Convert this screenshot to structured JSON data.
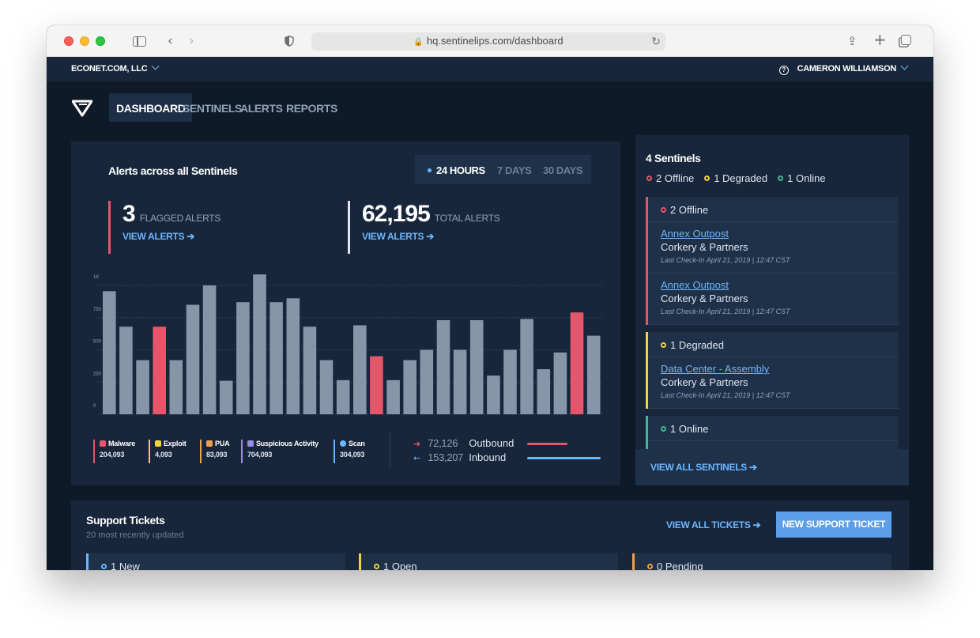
{
  "browser": {
    "url": "hq.sentinelips.com/dashboard"
  },
  "topbar": {
    "org": "ECONET.COM, LLC",
    "user": "CAMERON WILLIAMSON"
  },
  "nav": [
    "DASHBOARD",
    "SENTINELS",
    "ALERTS",
    "REPORTS"
  ],
  "alerts": {
    "title": "Alerts across all Sentinels",
    "ranges": [
      "24 HOURS",
      "7 DAYS",
      "30 DAYS"
    ],
    "flagged": {
      "value": "3",
      "label": "FLAGGED ALERTS",
      "link": "VIEW ALERTS ➔"
    },
    "total": {
      "value": "62,195",
      "label": "TOTAL ALERTS",
      "link": "VIEW ALERTS ➔"
    },
    "legend": [
      {
        "name": "Malware",
        "value": "204,093",
        "color": "#e5566a",
        "icon": "malware-icon"
      },
      {
        "name": "Exploit",
        "value": "4,093",
        "color": "#f4d03f",
        "icon": "hammer-icon"
      },
      {
        "name": "PUA",
        "value": "83,093",
        "color": "#f0a04b",
        "icon": "briefcase-icon"
      },
      {
        "name": "Suspicious Activity",
        "value": "704,093",
        "color": "#9b8be6",
        "icon": "spy-icon"
      },
      {
        "name": "Scan",
        "value": "304,093",
        "color": "#6bb6ff",
        "icon": "fingerprint-icon"
      }
    ],
    "traffic": [
      {
        "direction": "Outbound",
        "value": "72,126",
        "color": "#e5566a"
      },
      {
        "direction": "Inbound",
        "value": "153,207",
        "color": "#6bb6ff"
      }
    ]
  },
  "chart_data": {
    "type": "bar",
    "y_ticks": [
      "1K",
      "750",
      "500",
      "250",
      "0"
    ],
    "ylim": [
      0,
      1000
    ],
    "values": [
      955,
      680,
      420,
      680,
      420,
      850,
      1000,
      260,
      870,
      1085,
      870,
      900,
      680,
      420,
      265,
      690,
      450,
      265,
      420,
      500,
      730,
      500,
      730,
      300,
      500,
      740,
      350,
      480,
      790,
      610
    ],
    "flagged_indices": [
      3,
      16,
      28
    ],
    "colors": {
      "normal": "#8795a8",
      "flagged": "#e5566a"
    },
    "grid": true
  },
  "sentinels": {
    "title": "4 Sentinels",
    "summary": [
      {
        "label": "2 Offline",
        "color": "#e5566a"
      },
      {
        "label": "1 Degraded",
        "color": "#f4d03f"
      },
      {
        "label": "1 Online",
        "color": "#3fb98f"
      }
    ],
    "groups": [
      {
        "label": "2 Offline",
        "color": "#e5566a",
        "entries": [
          {
            "name": "Annex Outpost",
            "org": "Corkery & Partners",
            "checkin": "Last Check-In April 21, 2019 | 12:47 CST"
          },
          {
            "name": "Annex Outpost",
            "org": "Corkery & Partners",
            "checkin": "Last Check-In April 21, 2019 | 12:47 CST"
          }
        ]
      },
      {
        "label": "1 Degraded",
        "color": "#f4d03f",
        "entries": [
          {
            "name": "Data Center - Assembly",
            "org": "Corkery & Partners",
            "checkin": "Last Check-In April 21, 2019 | 12:47 CST"
          }
        ]
      },
      {
        "label": "1 Online",
        "color": "#3fb98f",
        "entries": []
      }
    ],
    "footer_link": "VIEW ALL SENTINELS ➔"
  },
  "tickets": {
    "title": "Support Tickets",
    "subtitle": "20 most recently updated",
    "view_all": "VIEW ALL TICKETS ➔",
    "new_button": "NEW SUPPORT TICKET",
    "columns": [
      {
        "label": "1 New",
        "color": "#6bb6ff"
      },
      {
        "label": "1 Open",
        "color": "#f4d03f"
      },
      {
        "label": "0 Pending",
        "color": "#f0a04b"
      }
    ]
  }
}
